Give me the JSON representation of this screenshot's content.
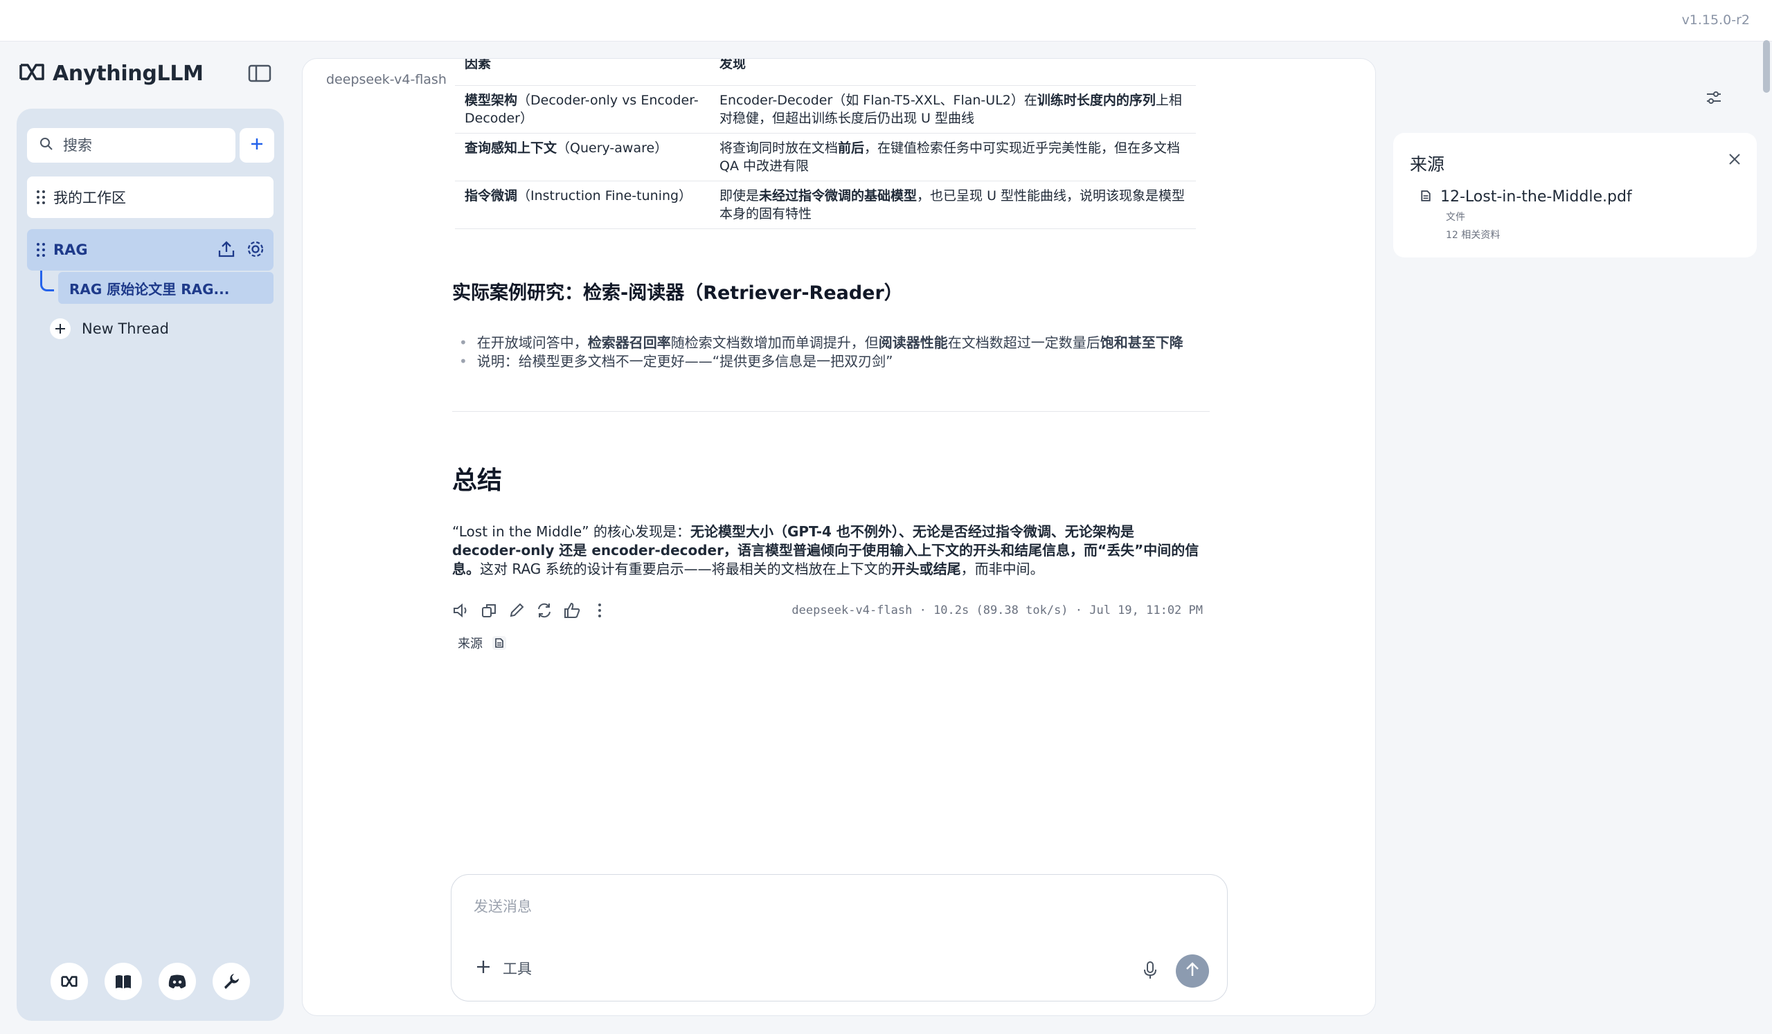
{
  "app": {
    "version": "v1.15.0-r2",
    "brand": "AnythingLLM"
  },
  "sidebar": {
    "search_placeholder": "搜索",
    "workspaces": [
      {
        "label": "我的工作区"
      },
      {
        "label": "RAG"
      }
    ],
    "active_thread": "RAG 原始论文里 RAG...",
    "new_thread": "New Thread",
    "footer_icons": [
      "anythingllm-logo-icon",
      "book-icon",
      "discord-icon",
      "wrench-icon"
    ]
  },
  "chat": {
    "model_tag": "deepseek-v4-flash",
    "table": {
      "headers": [
        "因素",
        "发现"
      ],
      "rows": [
        {
          "factor_bold": "模型架构",
          "factor_rest": "（Decoder-only vs Encoder-Decoder）",
          "finding_a": "Encoder-Decoder（如 Flan-T5-XXL、Flan-UL2）在",
          "finding_b": "训练时长度内的序列",
          "finding_c": "上相对稳健，但超出训练长度后仍出现 U 型曲线"
        },
        {
          "factor_bold": "查询感知上下文",
          "factor_rest": "（Query-aware）",
          "finding_a": "将查询同时放在文档",
          "finding_b": "前后",
          "finding_c": "，在键值检索任务中可实现近乎完美性能，但在多文档 QA 中改进有限"
        },
        {
          "factor_bold": "指令微调",
          "factor_rest": "（Instruction Fine-tuning）",
          "finding_a": "即使是",
          "finding_b": "未经过指令微调的基础模型",
          "finding_c": "，也已呈现 U 型性能曲线，说明该现象是模型本身的固有特性"
        }
      ]
    },
    "case_heading": "实际案例研究：检索-阅读器（Retriever-Reader）",
    "bullets": {
      "b1_a": "在开放域问答中，",
      "b1_b": "检索器召回率",
      "b1_c": "随检索文档数增加而单调提升，但",
      "b1_d": "阅读器性能",
      "b1_e": "在文档数超过一定数量后",
      "b1_f": "饱和甚至下降",
      "b2": "说明：给模型更多文档不一定更好——“提供更多信息是一把双刃剑”"
    },
    "summary_heading": "总结",
    "summary": {
      "s1": "“Lost in the Middle” 的核心发现是：",
      "s2": "无论模型大小（GPT-4 也不例外）、无论是否经过指令微调、无论架构是 decoder-only 还是 encoder-decoder，语言模型普遍倾向于使用输入上下文的开头和结尾信息，而“丢失”中间的信息。",
      "s3": "这对 RAG 系统的设计有重要启示——将最相关的文档放在上下文的",
      "s4": "开头或结尾",
      "s5": "，而非中间。"
    },
    "meta": "deepseek-v4-flash · 10.2s (89.38 tok/s) · Jul 19, 11:02 PM",
    "sources_label": "来源"
  },
  "composer": {
    "placeholder": "发送消息",
    "tools_label": "工具"
  },
  "sources_panel": {
    "title": "来源",
    "files": [
      {
        "name": "12-Lost-in-the-Middle.pdf",
        "type": "文件",
        "count": "12 相关资料"
      }
    ]
  }
}
